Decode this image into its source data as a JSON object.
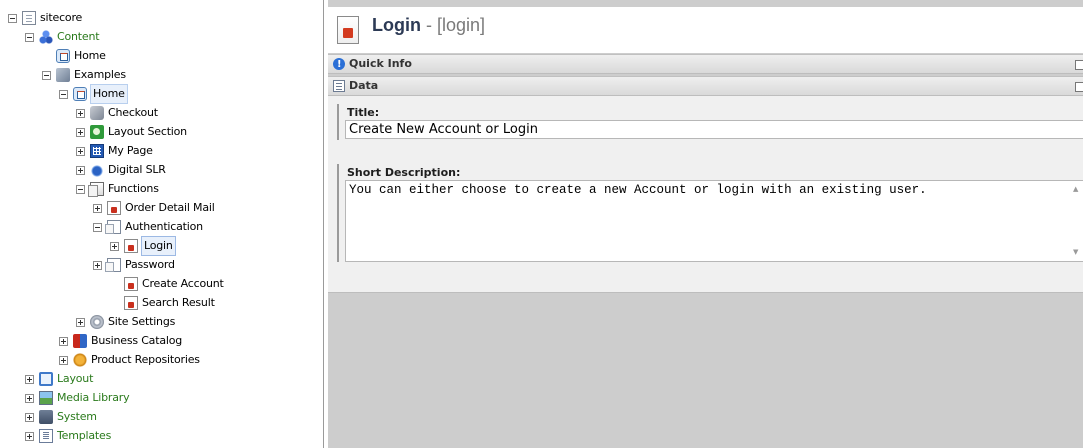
{
  "tree": [
    {
      "label": "sitecore",
      "icon": "sitecore-root-icon",
      "exp": "minus",
      "indent": 0,
      "green": false
    },
    {
      "label": "Content",
      "icon": "content-icon",
      "exp": "minus",
      "indent": 1,
      "green": true
    },
    {
      "label": "Home",
      "icon": "home-icon",
      "exp": "none",
      "indent": 2,
      "green": false
    },
    {
      "label": "Examples",
      "icon": "examples-icon",
      "exp": "minus",
      "indent": 2,
      "green": false
    },
    {
      "label": "Home",
      "icon": "home-icon",
      "exp": "minus",
      "indent": 3,
      "green": false,
      "state": "selhome"
    },
    {
      "label": "Checkout",
      "icon": "checkout-icon",
      "exp": "plus",
      "indent": 4,
      "green": false
    },
    {
      "label": "Layout Section",
      "icon": "layout-section-icon",
      "exp": "plus",
      "indent": 4,
      "green": false
    },
    {
      "label": "My Page",
      "icon": "my-page-icon",
      "exp": "plus",
      "indent": 4,
      "green": false
    },
    {
      "label": "Digital SLR",
      "icon": "digital-slr-icon",
      "exp": "plus",
      "indent": 4,
      "green": false
    },
    {
      "label": "Functions",
      "icon": "functions-icon",
      "exp": "minus",
      "indent": 4,
      "green": false
    },
    {
      "label": "Order Detail Mail",
      "icon": "red-document-icon",
      "exp": "plus",
      "indent": 5,
      "green": false
    },
    {
      "label": "Authentication",
      "icon": "folder-pages-icon",
      "exp": "minus",
      "indent": 5,
      "green": false
    },
    {
      "label": "Login",
      "icon": "red-document-icon",
      "exp": "plus",
      "indent": 6,
      "green": false,
      "state": "sel"
    },
    {
      "label": "Password",
      "icon": "folder-pages-icon",
      "exp": "plus",
      "indent": 5,
      "green": false
    },
    {
      "label": "Create Account",
      "icon": "red-document-icon",
      "exp": "none",
      "indent": 6,
      "green": false
    },
    {
      "label": "Search Result",
      "icon": "red-document-icon",
      "exp": "none",
      "indent": 6,
      "green": false
    },
    {
      "label": "Site Settings",
      "icon": "site-settings-icon",
      "exp": "plus",
      "indent": 4,
      "green": false
    },
    {
      "label": "Business Catalog",
      "icon": "business-catalog-icon",
      "exp": "plus",
      "indent": 3,
      "green": false
    },
    {
      "label": "Product Repositories",
      "icon": "product-repositories-icon",
      "exp": "plus",
      "indent": 3,
      "green": false
    },
    {
      "label": "Layout",
      "icon": "layout-icon",
      "exp": "plus",
      "indent": 1,
      "green": true
    },
    {
      "label": "Media Library",
      "icon": "media-library-icon",
      "exp": "plus",
      "indent": 1,
      "green": true
    },
    {
      "label": "System",
      "icon": "system-icon",
      "exp": "plus",
      "indent": 1,
      "green": true
    },
    {
      "label": "Templates",
      "icon": "templates-icon",
      "exp": "plus",
      "indent": 1,
      "green": true
    }
  ],
  "editor": {
    "title": "Login",
    "subtitle": " - [login]",
    "title_icon": "login-item-icon",
    "quick_info_label": "Quick Info",
    "data_label": "Data",
    "title_field_label": "Title:",
    "title_field_value": "Create New Account or Login",
    "short_desc_label": "Short Description:",
    "short_desc_value": "You can either choose to create a new Account or login with an existing user."
  }
}
